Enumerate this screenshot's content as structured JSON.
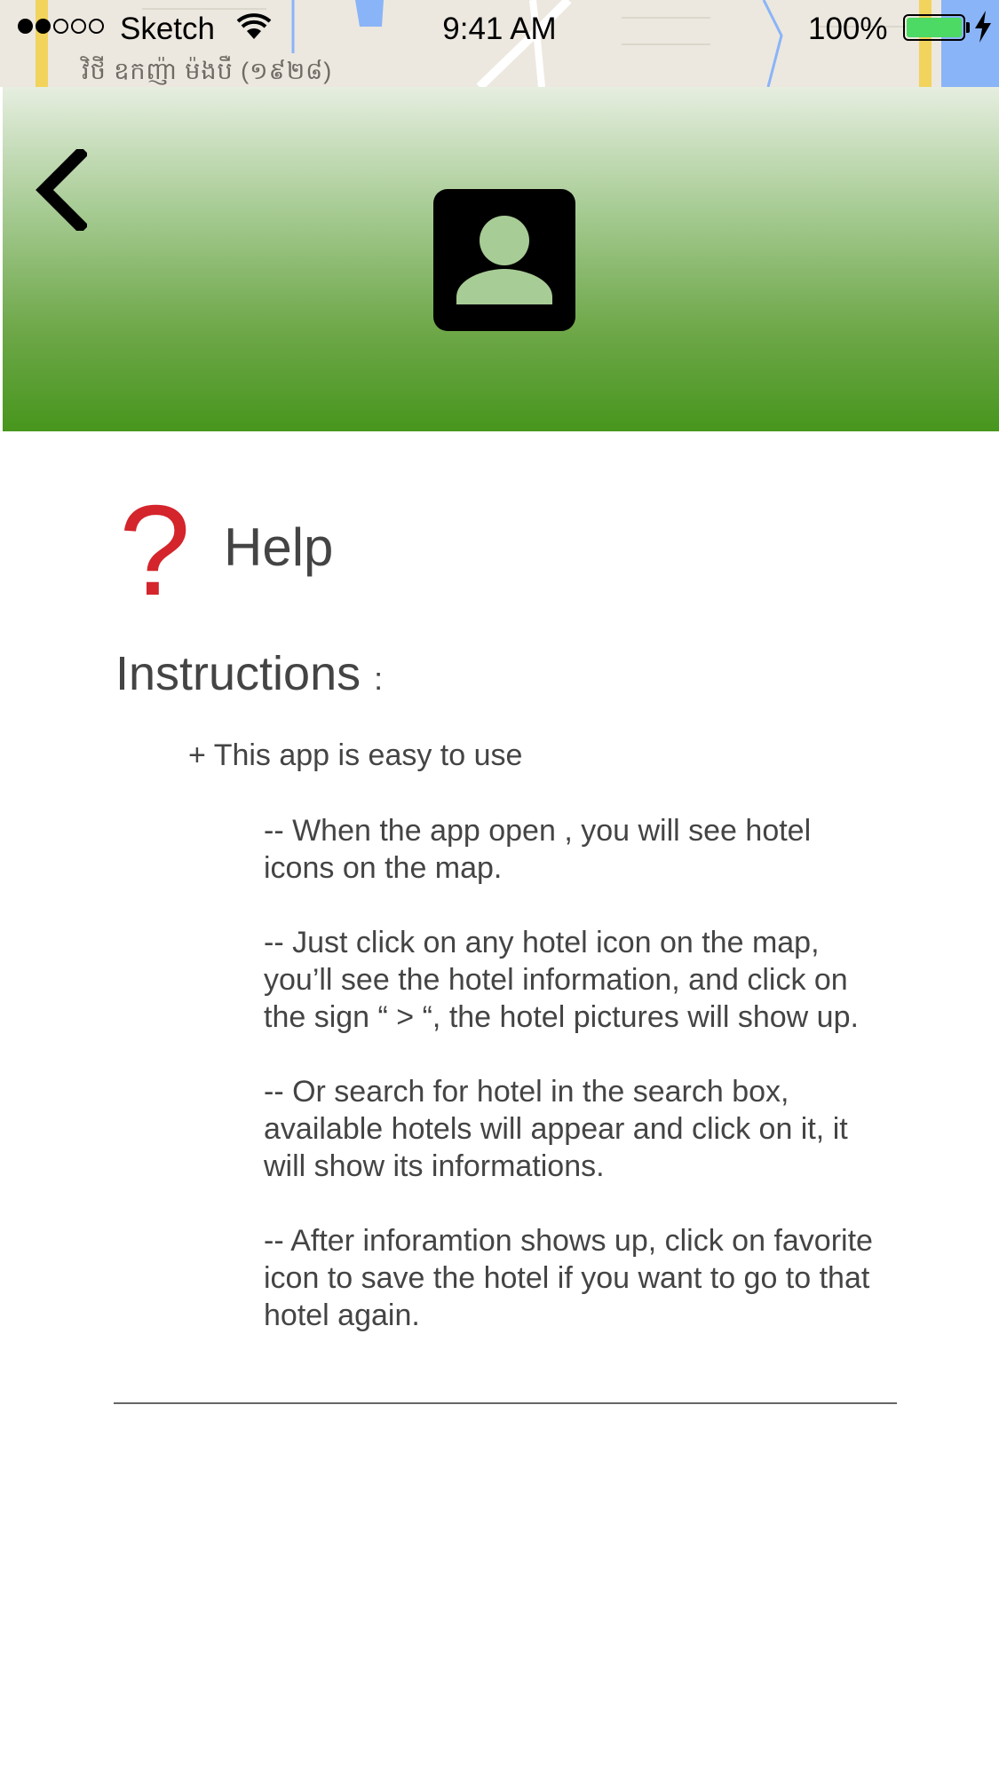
{
  "status_bar": {
    "carrier": "Sketch",
    "time": "9:41 AM",
    "battery_percent": "100%",
    "battery_level": 1.0,
    "signal_strength": 2,
    "signal_total": 5
  },
  "map": {
    "label": "វិថី ឧកញ៉ា ម៉ងបឺ (១៩២៨)"
  },
  "header": {
    "back_icon": "chevron-left-icon",
    "profile_icon": "account-box-icon",
    "gradient_colors": [
      "#e6eee0",
      "#47961d"
    ]
  },
  "help": {
    "icon": "question-mark-icon",
    "icon_color": "#d4242c",
    "title": "Help"
  },
  "instructions": {
    "heading": "Instructions",
    "heading_suffix": ":",
    "intro": "+ This app is easy to use",
    "steps": [
      "-- When the app open , you will see hotel\nicons on the map.",
      "-- Just click on any hotel icon on the map,\nyou’ll see the hotel information, and click on\nthe sign “ > “, the hotel pictures will show up.",
      "-- Or search for hotel in the search box,\navailable hotels will appear and click on it, it\nwill show  its informations.",
      "-- After inforamtion shows up, click on favorite\nicon to save the hotel if you want to go to that\nhotel again."
    ]
  }
}
